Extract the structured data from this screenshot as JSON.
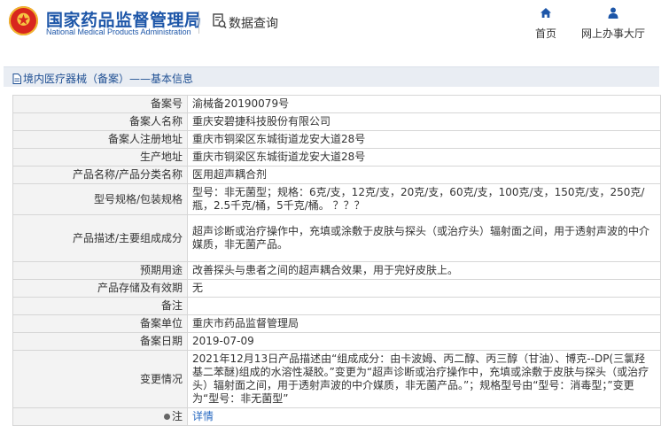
{
  "header": {
    "site_name_cn": "国家药品监督管理局",
    "site_name_en": "National Medical Products Administration",
    "page_label": "数据查询",
    "nav": [
      {
        "label": "首页",
        "icon": "home-icon"
      },
      {
        "label": "网上办事大厅",
        "icon": "user-icon"
      }
    ]
  },
  "breadcrumb": {
    "text": "境内医疗器械（备案）——基本信息"
  },
  "record": {
    "rows": [
      {
        "key": "备案号",
        "value": "渝械备20190079号"
      },
      {
        "key": "备案人名称",
        "value": "重庆安碧捷科技股份有限公司"
      },
      {
        "key": "备案人注册地址",
        "value": "重庆市铜梁区东城街道龙安大道28号"
      },
      {
        "key": "生产地址",
        "value": "重庆市铜梁区东城街道龙安大道28号"
      },
      {
        "key": "产品名称/产品分类名称",
        "value": "医用超声耦合剂"
      },
      {
        "key": "型号规格/包装规格",
        "value": "型号：非无菌型；规格：6克/支，12克/支，20克/支，60克/支，100克/支，150克/支，250克/瓶，2.5千克/桶，5千克/桶。 ？？？"
      },
      {
        "key": "产品描述/主要组成成分",
        "value": "超声诊断或治疗操作中，充填或涂敷于皮肤与探头（或治疗头）辐射面之间，用于透射声波的中介媒质，非无菌产品。"
      },
      {
        "key": "预期用途",
        "value": "改善探头与患者之间的超声耦合效果，用于完好皮肤上。"
      },
      {
        "key": "产品存储及有效期",
        "value": "无"
      },
      {
        "key": "备注",
        "value": ""
      },
      {
        "key": "备案单位",
        "value": "重庆市药品监督管理局"
      },
      {
        "key": "备案日期",
        "value": "2019-07-09"
      },
      {
        "key": "变更情况",
        "value": "2021年12月13日产品描述由“组成成分：由卡波姆、丙二醇、丙三醇（甘油）、博克--DP(三氯羟基二苯醚)组成的水溶性凝胶。”变更为“超声诊断或治疗操作中，充填或涂敷于皮肤与探头（或治疗头）辐射面之间，用于透射声波的中介媒质，非无菌产品。”；规格型号由“型号：消毒型；”变更为“型号：非无菌型”"
      }
    ],
    "note_key": "注",
    "note_link": "详情"
  }
}
